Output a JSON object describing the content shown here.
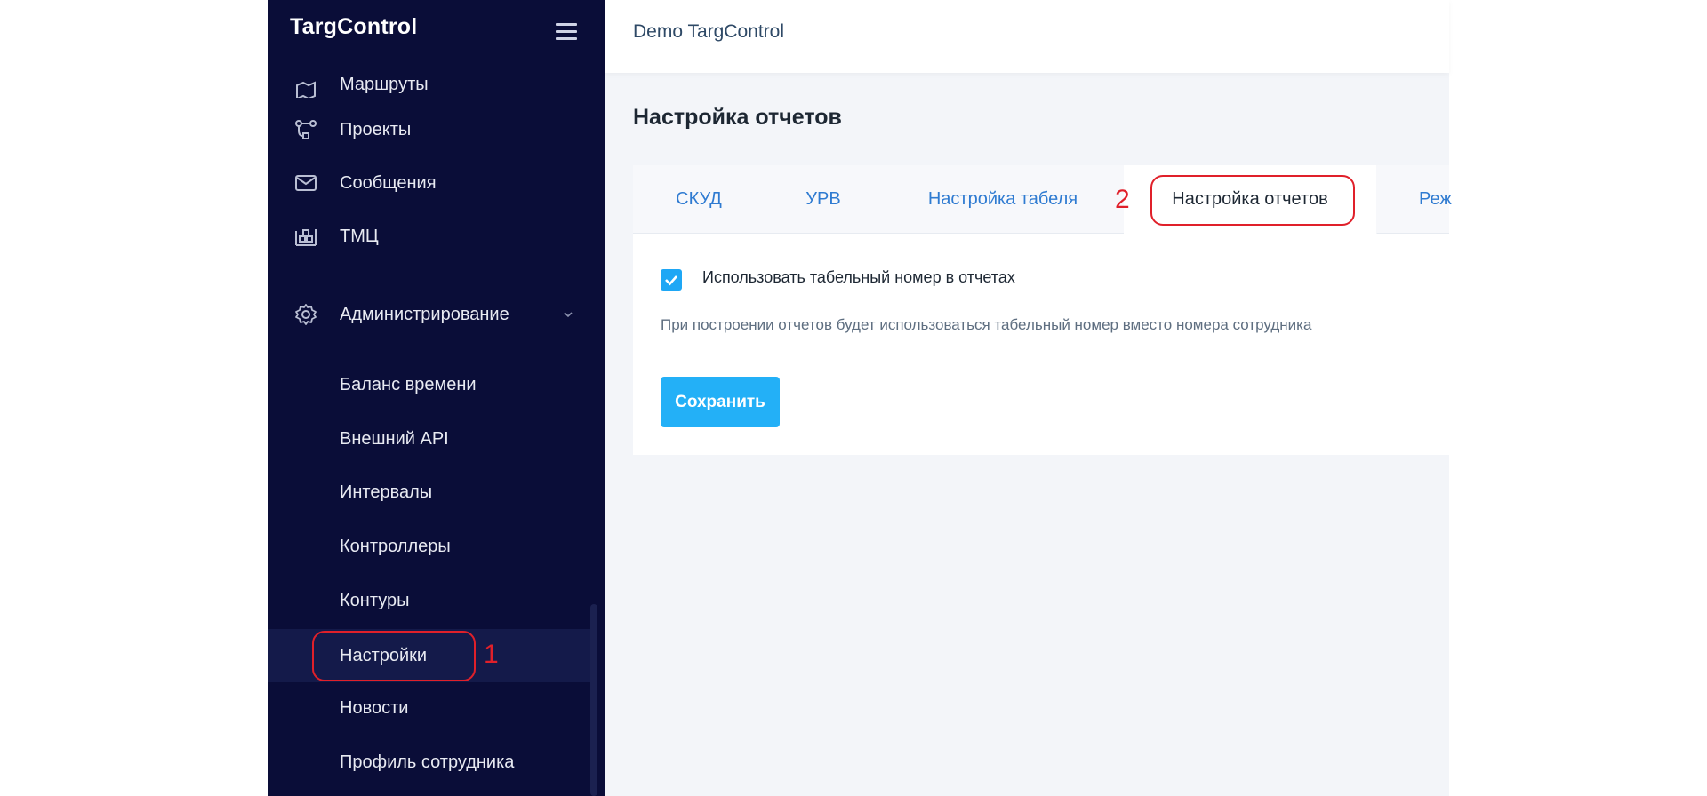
{
  "app": {
    "logo": "TargControl"
  },
  "sidebar": {
    "cut_item_label": "Маршруты",
    "items": [
      {
        "label": "Проекты",
        "icon": "projects-icon"
      },
      {
        "label": "Сообщения",
        "icon": "mail-icon"
      },
      {
        "label": "ТМЦ",
        "icon": "warehouse-icon"
      },
      {
        "label": "Администрирование",
        "icon": "gear-icon"
      }
    ],
    "sub_items": [
      {
        "label": "Баланс времени"
      },
      {
        "label": "Внешний API"
      },
      {
        "label": "Интервалы"
      },
      {
        "label": "Контроллеры"
      },
      {
        "label": "Контуры"
      },
      {
        "label": "Настройки"
      },
      {
        "label": "Новости"
      },
      {
        "label": "Профиль сотрудника"
      }
    ]
  },
  "header": {
    "title": "Demo TargControl"
  },
  "page": {
    "title": "Настройка отчетов",
    "tabs": [
      {
        "label": "СКУД"
      },
      {
        "label": "УРВ"
      },
      {
        "label": "Настройка табеля"
      },
      {
        "label": "Настройка отчетов"
      },
      {
        "label": "Реж"
      }
    ],
    "checkbox": {
      "label": "Использовать табельный номер в отчетах",
      "checked": true
    },
    "hint": "При построении отчетов будет использоваться табельный номер вместо номера сотрудника",
    "save_label": "Сохранить"
  },
  "annotations": {
    "mark1": "1",
    "mark2": "2"
  },
  "colors": {
    "sidebar_bg": "#0a0d38",
    "accent": "#23b0f7",
    "annotation": "#e0202a",
    "tab_text": "#2f7bd1"
  }
}
